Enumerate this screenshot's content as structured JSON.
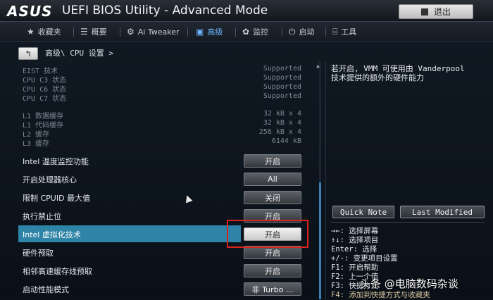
{
  "window": {
    "brand": "ASUS",
    "title": "UEFI BIOS Utility - Advanced Mode",
    "exit_label": "退出"
  },
  "nav": {
    "tabs": [
      {
        "label": "收藏夹",
        "icon": "star-icon"
      },
      {
        "label": "概要",
        "icon": "list-icon"
      },
      {
        "label": "Ai Tweaker",
        "icon": "tweaker-icon"
      },
      {
        "label": "高级",
        "icon": "advanced-icon",
        "active": true
      },
      {
        "label": "监控",
        "icon": "monitor-icon"
      },
      {
        "label": "启动",
        "icon": "power-icon"
      },
      {
        "label": "工具",
        "icon": "tool-icon"
      }
    ]
  },
  "breadcrumb": "高级\\ CPU 设置 >",
  "info_rows": [
    {
      "label": "EIST 技术",
      "value": "Supported"
    },
    {
      "label": "CPU C3 状态",
      "value": "Supported"
    },
    {
      "label": "CPU C6 状态",
      "value": "Supported"
    },
    {
      "label": "CPU C7 状态",
      "value": "Supported"
    },
    {
      "label": "L1 数据缓存",
      "value": "32 kB x 4"
    },
    {
      "label": "L1 代码缓存",
      "value": "32 kB x 4"
    },
    {
      "label": "L2 缓存",
      "value": "256 kB x 4"
    },
    {
      "label": "L3 缓存",
      "value": "6144 kB"
    }
  ],
  "settings": [
    {
      "label": "Intel 温度监控功能",
      "value": "开启"
    },
    {
      "label": "开启处理器核心",
      "value": "All"
    },
    {
      "label": "限制 CPUID 最大值",
      "value": "关闭"
    },
    {
      "label": "执行禁止位",
      "value": "开启"
    },
    {
      "label": "Intel 虚拟化技术",
      "value": "开启",
      "selected": true
    },
    {
      "label": "硬件预取",
      "value": "开启"
    },
    {
      "label": "相邻高速缓存线预取",
      "value": "开启"
    },
    {
      "label": "启动性能模式",
      "value": "非 Turbo ..."
    }
  ],
  "help": {
    "line1": "若开启, VMM 可使用由 Vanderpool",
    "line2": "技术提供的额外的硬件能力"
  },
  "side_buttons": {
    "quick_note": "Quick Note",
    "last_modified": "Last Modified"
  },
  "keys": [
    "→←: 选择屏幕",
    "↑↓: 选择项目",
    "Enter: 选择",
    "+/-: 变更项目设置",
    "F1: 开启帮助",
    "F2: 上一个值",
    "F3: 快捷方式",
    "F4: 添加到快捷方式与收藏夹"
  ],
  "watermark": "头条 @电脑数码杂谈",
  "colors": {
    "accent": "#6fb8ff",
    "selected_row": "#2e84a6",
    "highlight_box": "#d9241e"
  }
}
